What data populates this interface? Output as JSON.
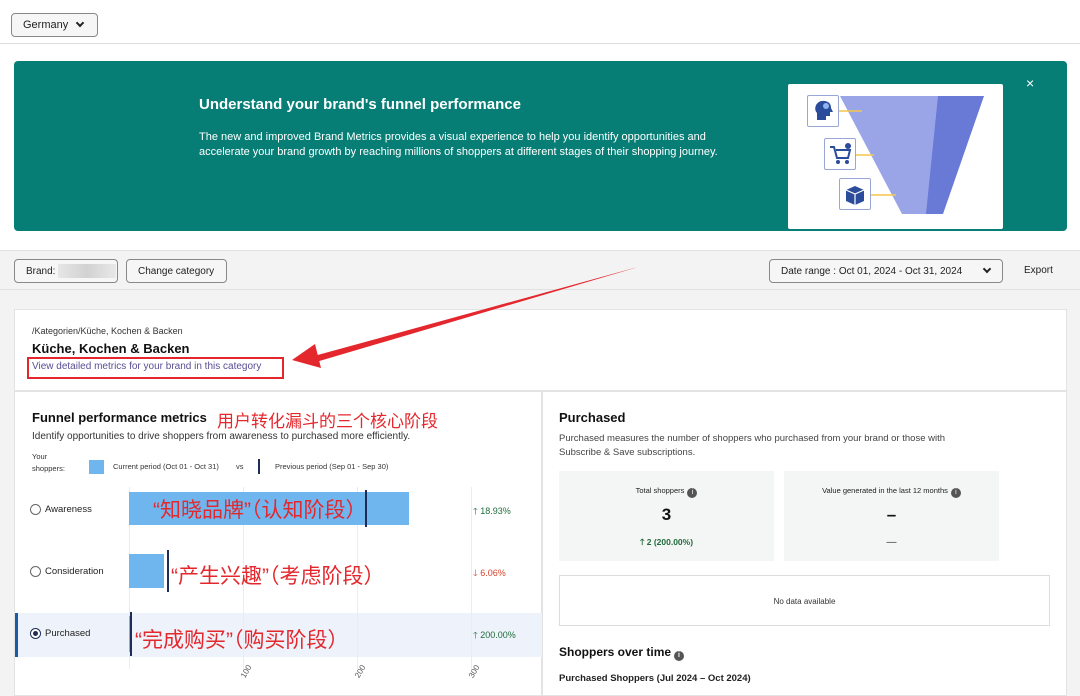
{
  "topbar": {
    "country": "Germany"
  },
  "banner": {
    "title": "Understand your brand's funnel performance",
    "text": "The new and improved Brand Metrics provides a visual experience to help you identify opportunities and accelerate your brand growth by reaching millions of shoppers at different stages of their shopping journey.",
    "close": "×",
    "funnel_colors": [
      "#9aa5e8",
      "#6879d6"
    ]
  },
  "toolbar": {
    "brand_label": "Brand:",
    "change_category": "Change category",
    "date_range": "Date range : Oct 01, 2024 - Oct 31, 2024",
    "export": "Export"
  },
  "category": {
    "path": "/Kategorien/Küche, Kochen & Backen",
    "title": "Küche, Kochen & Backen",
    "link": "View detailed metrics for your brand in this category"
  },
  "funnel": {
    "title": "Funnel performance metrics",
    "annotation_title": "用户转化漏斗的三个核心阶段",
    "subtitle": "Identify opportunities to drive shoppers from awareness to purchased more efficiently.",
    "legend_label_1": "Your",
    "legend_label_2": "shoppers:",
    "legend_current": "Current period (Oct 01 - Oct 31)",
    "legend_vs": "vs",
    "legend_previous": "Previous period (Sep 01 - Sep 30)",
    "stages": [
      {
        "label": "Awareness",
        "annotation": "“知晓品牌”（认知阶段）",
        "change": "18.93%",
        "dir": "up",
        "selected": false
      },
      {
        "label": "Consideration",
        "annotation": "“产生兴趣”（考虑阶段）",
        "change": "6.06%",
        "dir": "down",
        "selected": false
      },
      {
        "label": "Purchased",
        "annotation": "“完成购买”（购买阶段）",
        "change": "200.00%",
        "dir": "up",
        "selected": true
      }
    ],
    "ticks": [
      "100",
      "200",
      "300"
    ],
    "colors": {
      "current": "#6fb6ee",
      "previous": "#1d2d55",
      "up": "#1f6b3a",
      "down": "#d9422b"
    }
  },
  "chart_data": {
    "type": "bar",
    "categories": [
      "Awareness",
      "Consideration",
      "Purchased"
    ],
    "series": [
      {
        "name": "Current period (Oct 01 - Oct 31)",
        "values": [
          246,
          31,
          3
        ]
      },
      {
        "name": "Previous period (Sep 01 - Sep 30)",
        "values": [
          207,
          33,
          1
        ]
      }
    ],
    "xlim": [
      0,
      300
    ],
    "xticks": [
      "100",
      "200",
      "300"
    ],
    "orientation": "horizontal"
  },
  "purchased": {
    "title": "Purchased",
    "description": "Purchased measures the number of shoppers who purchased from your brand or those with Subscribe & Save subscriptions.",
    "total_label": "Total shoppers",
    "total_value": "3",
    "total_change": "2 (200.00%)",
    "value_label": "Value generated in the last 12 months",
    "value_value": "–",
    "value_change": "—",
    "no_data": "No data available",
    "sot_title": "Shoppers over time",
    "sot_sub": "Purchased Shoppers (Jul 2024 – Oct 2024)"
  }
}
